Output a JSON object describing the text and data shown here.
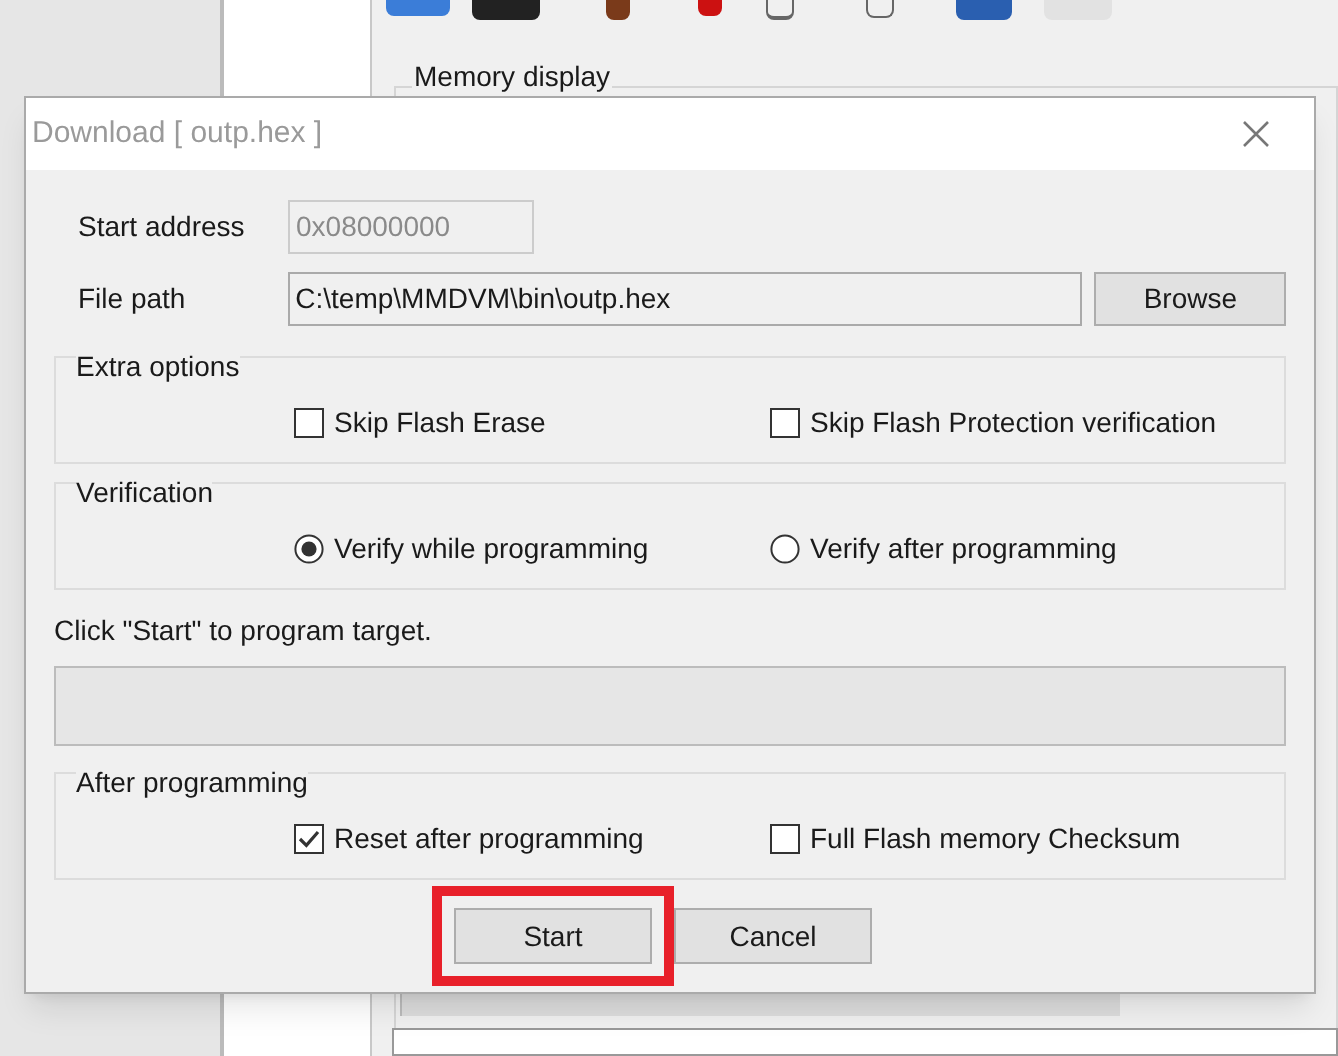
{
  "background": {
    "memory_display_label": "Memory display"
  },
  "dialog": {
    "title": "Download [ outp.hex ]",
    "start_address": {
      "label": "Start address",
      "value": "0x08000000",
      "disabled": true
    },
    "file_path": {
      "label": "File path",
      "value": "C:\\temp\\MMDVM\\bin\\outp.hex",
      "button": "Browse"
    },
    "extra_options": {
      "title": "Extra options",
      "options": [
        {
          "label": "Skip Flash Erase",
          "checked": false
        },
        {
          "label": "Skip Flash Protection verification",
          "checked": false
        }
      ]
    },
    "verification": {
      "title": "Verification",
      "options": [
        {
          "label": "Verify while programming",
          "selected": true
        },
        {
          "label": "Verify after programming",
          "selected": false
        }
      ]
    },
    "status": "Click \"Start\" to program target.",
    "progress": {
      "level": 0
    },
    "after_programming": {
      "title": "After programming",
      "options": [
        {
          "label": "Reset after programming",
          "checked": true
        },
        {
          "label": "Full Flash memory Checksum",
          "checked": false
        }
      ]
    },
    "buttons": [
      {
        "label": "Start",
        "highlighted": true
      },
      {
        "label": "Cancel",
        "highlighted": false
      }
    ]
  }
}
